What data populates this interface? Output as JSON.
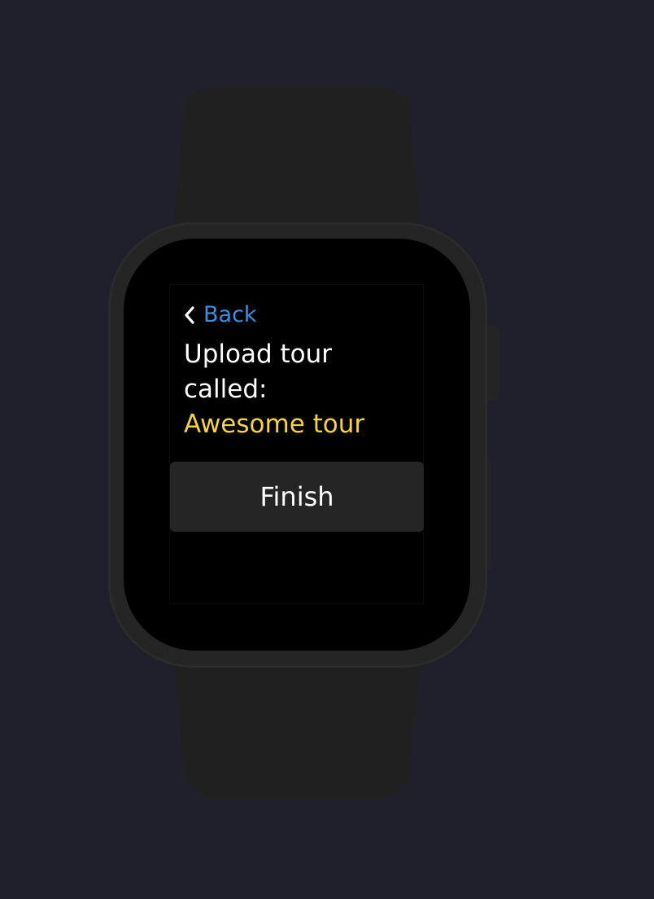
{
  "nav": {
    "back_label": "Back",
    "back_icon": "chevron-left-icon"
  },
  "upload": {
    "prompt_line1": "Upload tour",
    "prompt_line2": "called:",
    "tour_name": "Awesome tour"
  },
  "actions": {
    "finish_label": "Finish"
  },
  "colors": {
    "background": "#1f202b",
    "link": "#3d8fe0",
    "highlight": "#f5d33a",
    "button": "#252525",
    "text": "#ffffff"
  }
}
